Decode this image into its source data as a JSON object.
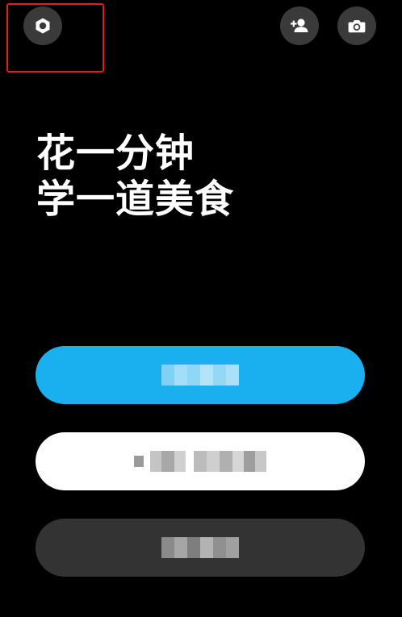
{
  "header": {
    "settings_icon": "settings-icon",
    "add_friend_icon": "add-friend-icon",
    "camera_icon": "camera-icon"
  },
  "headline": {
    "line1": "花一分钟",
    "line2": "学一道美食"
  },
  "colors": {
    "background": "#000000",
    "icon_button": "#3a3a3a",
    "primary": "#1ab0f0",
    "secondary": "#ffffff",
    "tertiary": "#333333",
    "highlight": "#e11d1d"
  }
}
